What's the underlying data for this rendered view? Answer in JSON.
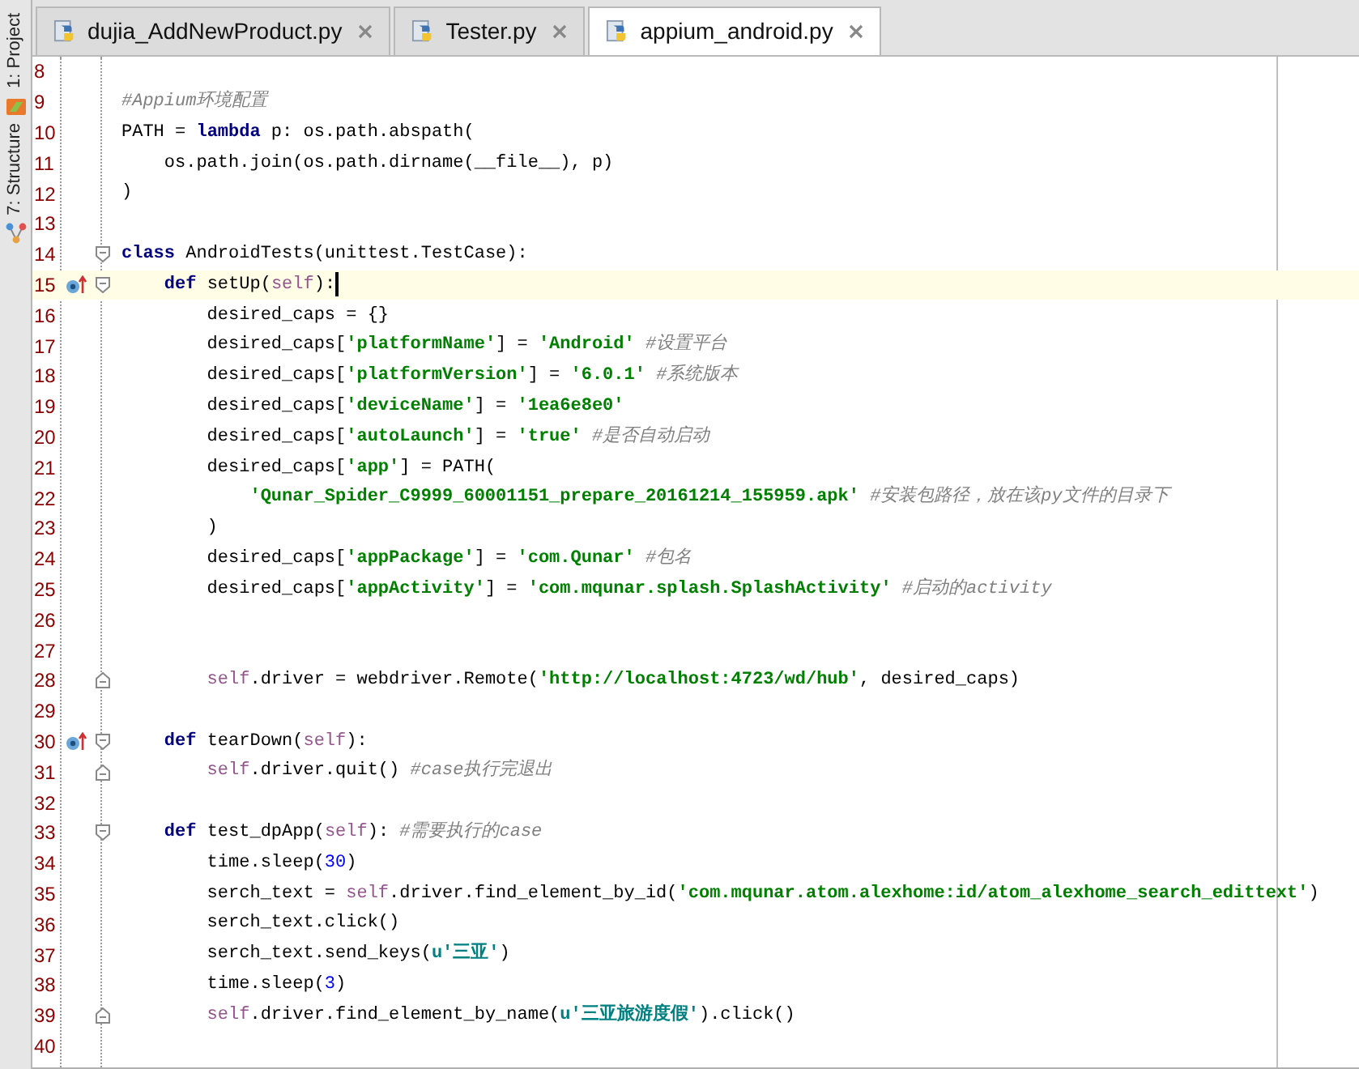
{
  "tool_strip": [
    {
      "label": "1: Project"
    },
    {
      "label": "7: Structure"
    }
  ],
  "tabs": [
    {
      "label": "dujia_AddNewProduct.py",
      "selected": false
    },
    {
      "label": "Tester.py",
      "selected": false
    },
    {
      "label": "appium_android.py",
      "selected": true
    }
  ],
  "editor": {
    "lines": [
      {
        "number": "8"
      },
      {
        "number": "9",
        "tokens": [
          {
            "kind": "comment",
            "text": "#Appium环境配置"
          }
        ]
      },
      {
        "number": "10",
        "tokens": [
          {
            "kind": "plain",
            "text": "PATH = "
          },
          {
            "kind": "keyword",
            "text": "lambda"
          },
          {
            "kind": "plain",
            "text": " p: os.path.abspath("
          }
        ]
      },
      {
        "number": "11",
        "tokens": [
          {
            "kind": "plain",
            "text": "    os.path.join(os.path.dirname(__file__), p)"
          }
        ]
      },
      {
        "number": "12",
        "tokens": [
          {
            "kind": "plain",
            "text": ")"
          }
        ]
      },
      {
        "number": "13"
      },
      {
        "number": "14",
        "fold_start": true,
        "tokens": [
          {
            "kind": "keyword",
            "text": "class"
          },
          {
            "kind": "plain",
            "text": " AndroidTests(unittest.TestCase):"
          }
        ]
      },
      {
        "number": "15",
        "fold_start": true,
        "override": true,
        "current": true,
        "tokens": [
          {
            "kind": "keyword",
            "text": "    def"
          },
          {
            "kind": "plain",
            "text": " setUp("
          },
          {
            "kind": "self",
            "text": "self"
          },
          {
            "kind": "plain",
            "text": "):"
          }
        ]
      },
      {
        "number": "16",
        "tokens": [
          {
            "kind": "plain",
            "text": "        desired_caps = {}"
          }
        ]
      },
      {
        "number": "17",
        "tokens": [
          {
            "kind": "plain",
            "text": "        desired_caps["
          },
          {
            "kind": "string",
            "text": "'platformName'"
          },
          {
            "kind": "plain",
            "text": "] = "
          },
          {
            "kind": "string",
            "text": "'Android'"
          },
          {
            "kind": "comment",
            "text": " #设置平台"
          }
        ]
      },
      {
        "number": "18",
        "tokens": [
          {
            "kind": "plain",
            "text": "        desired_caps["
          },
          {
            "kind": "string",
            "text": "'platformVersion'"
          },
          {
            "kind": "plain",
            "text": "] = "
          },
          {
            "kind": "string",
            "text": "'6.0.1'"
          },
          {
            "kind": "comment",
            "text": " #系统版本"
          }
        ]
      },
      {
        "number": "19",
        "tokens": [
          {
            "kind": "plain",
            "text": "        desired_caps["
          },
          {
            "kind": "string",
            "text": "'deviceName'"
          },
          {
            "kind": "plain",
            "text": "] = "
          },
          {
            "kind": "string",
            "text": "'1ea6e8e0'"
          }
        ]
      },
      {
        "number": "20",
        "tokens": [
          {
            "kind": "plain",
            "text": "        desired_caps["
          },
          {
            "kind": "string",
            "text": "'autoLaunch'"
          },
          {
            "kind": "plain",
            "text": "] = "
          },
          {
            "kind": "string",
            "text": "'true'"
          },
          {
            "kind": "comment",
            "text": " #是否自动启动"
          }
        ]
      },
      {
        "number": "21",
        "tokens": [
          {
            "kind": "plain",
            "text": "        desired_caps["
          },
          {
            "kind": "string",
            "text": "'app'"
          },
          {
            "kind": "plain",
            "text": "] = PATH("
          }
        ]
      },
      {
        "number": "22",
        "tokens": [
          {
            "kind": "string",
            "text": "            'Qunar_Spider_C9999_60001151_prepare_20161214_155959.apk'"
          },
          {
            "kind": "comment",
            "text": " #安装包路径，放在该py文件的目录下"
          }
        ]
      },
      {
        "number": "23",
        "tokens": [
          {
            "kind": "plain",
            "text": "        )"
          }
        ]
      },
      {
        "number": "24",
        "tokens": [
          {
            "kind": "plain",
            "text": "        desired_caps["
          },
          {
            "kind": "string",
            "text": "'appPackage'"
          },
          {
            "kind": "plain",
            "text": "] = "
          },
          {
            "kind": "string",
            "text": "'com.Qunar'"
          },
          {
            "kind": "comment",
            "text": " #包名"
          }
        ]
      },
      {
        "number": "25",
        "tokens": [
          {
            "kind": "plain",
            "text": "        desired_caps["
          },
          {
            "kind": "string",
            "text": "'appActivity'"
          },
          {
            "kind": "plain",
            "text": "] = "
          },
          {
            "kind": "string",
            "text": "'com.mqunar.splash.SplashActivity'"
          },
          {
            "kind": "comment",
            "text": " #启动的activity"
          }
        ]
      },
      {
        "number": "26"
      },
      {
        "number": "27"
      },
      {
        "number": "28",
        "fold_end": true,
        "tokens": [
          {
            "kind": "self",
            "text": "        self"
          },
          {
            "kind": "plain",
            "text": ".driver = webdriver.Remote("
          },
          {
            "kind": "string",
            "text": "'http://localhost:4723/wd/hub'"
          },
          {
            "kind": "plain",
            "text": ", desired_caps)"
          }
        ]
      },
      {
        "number": "29"
      },
      {
        "number": "30",
        "fold_start": true,
        "override": true,
        "tokens": [
          {
            "kind": "keyword",
            "text": "    def"
          },
          {
            "kind": "plain",
            "text": " tearDown("
          },
          {
            "kind": "self",
            "text": "self"
          },
          {
            "kind": "plain",
            "text": "):"
          }
        ]
      },
      {
        "number": "31",
        "fold_end": true,
        "tokens": [
          {
            "kind": "self",
            "text": "        self"
          },
          {
            "kind": "plain",
            "text": ".driver.quit()"
          },
          {
            "kind": "comment",
            "text": " #case执行完退出"
          }
        ]
      },
      {
        "number": "32"
      },
      {
        "number": "33",
        "fold_start": true,
        "tokens": [
          {
            "kind": "keyword",
            "text": "    def"
          },
          {
            "kind": "plain",
            "text": " test_dpApp("
          },
          {
            "kind": "self",
            "text": "self"
          },
          {
            "kind": "plain",
            "text": "):"
          },
          {
            "kind": "comment",
            "text": " #需要执行的case"
          }
        ]
      },
      {
        "number": "34",
        "tokens": [
          {
            "kind": "plain",
            "text": "        time.sleep("
          },
          {
            "kind": "number",
            "text": "30"
          },
          {
            "kind": "plain",
            "text": ")"
          }
        ]
      },
      {
        "number": "35",
        "tokens": [
          {
            "kind": "plain",
            "text": "        serch_text = "
          },
          {
            "kind": "self",
            "text": "self"
          },
          {
            "kind": "plain",
            "text": ".driver.find_element_by_id("
          },
          {
            "kind": "string",
            "text": "'com.mqunar.atom.alexhome:id/atom_alexhome_search_edittext'"
          },
          {
            "kind": "plain",
            "text": ")"
          }
        ]
      },
      {
        "number": "36",
        "tokens": [
          {
            "kind": "plain",
            "text": "        serch_text.click()"
          }
        ]
      },
      {
        "number": "37",
        "tokens": [
          {
            "kind": "plain",
            "text": "        serch_text.send_keys("
          },
          {
            "kind": "unicode",
            "text": "u'三亚'"
          },
          {
            "kind": "plain",
            "text": ")"
          }
        ]
      },
      {
        "number": "38",
        "tokens": [
          {
            "kind": "plain",
            "text": "        time.sleep("
          },
          {
            "kind": "number",
            "text": "3"
          },
          {
            "kind": "plain",
            "text": ")"
          }
        ]
      },
      {
        "number": "39",
        "fold_end": true,
        "tokens": [
          {
            "kind": "self",
            "text": "        self"
          },
          {
            "kind": "plain",
            "text": ".driver.find_element_by_name("
          },
          {
            "kind": "unicode",
            "text": "u'三亚旅游度假'"
          },
          {
            "kind": "plain",
            "text": ").click()"
          }
        ]
      },
      {
        "number": "40"
      }
    ]
  }
}
